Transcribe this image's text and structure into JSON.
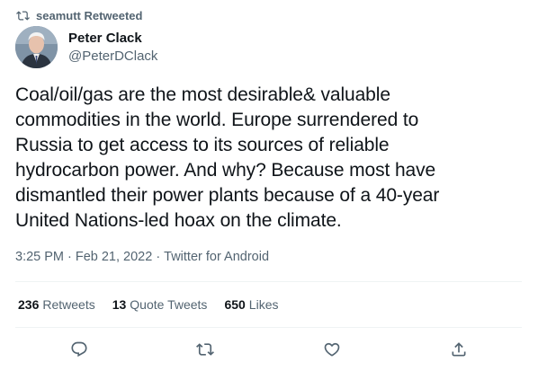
{
  "retweet": {
    "text": "seamutt Retweeted",
    "icon": "retweet-icon"
  },
  "author": {
    "name": "Peter Clack",
    "handle": "@PeterDClack",
    "avatar": "avatar"
  },
  "tweet": {
    "text": "Coal/oil/gas are the most desirable& valuable\ncommodities in the world. Europe surrendered to\nRussia to get access to its sources of reliable\nhydrocarbon power. And why? Because most have\ndismantled their power plants because of a 40-year\nUnited Nations-led hoax on the climate.",
    "time": "3:25 PM",
    "sep1": "·",
    "date": "Feb 21, 2022",
    "sep2": "·",
    "source": "Twitter for Android"
  },
  "stats": {
    "retweets": {
      "count": "236",
      "label": "Retweets"
    },
    "quotes": {
      "count": "13",
      "label": "Quote Tweets"
    },
    "likes": {
      "count": "650",
      "label": "Likes"
    }
  },
  "actions": {
    "reply": "reply-icon",
    "retweet": "retweet-icon",
    "like": "like-icon",
    "share": "share-icon"
  },
  "colors": {
    "text_primary": "#0f1419",
    "text_secondary": "#536471",
    "divider": "#eff3f4",
    "background": "#ffffff"
  }
}
